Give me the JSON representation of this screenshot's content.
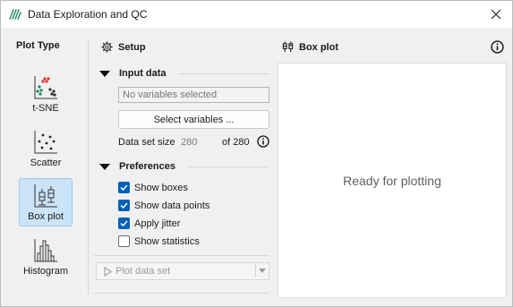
{
  "window": {
    "title": "Data Exploration and QC"
  },
  "plot_type": {
    "title": "Plot Type",
    "items": [
      {
        "label": "t-SNE",
        "icon": "tsne-icon",
        "selected": false
      },
      {
        "label": "Scatter",
        "icon": "scatter-icon",
        "selected": false
      },
      {
        "label": "Box plot",
        "icon": "boxplot-icon",
        "selected": true
      },
      {
        "label": "Histogram",
        "icon": "histogram-icon",
        "selected": false
      }
    ]
  },
  "setup": {
    "title": "Setup",
    "input_data": {
      "title": "Input data",
      "variables_placeholder": "No variables selected",
      "select_button": "Select variables ...",
      "dataset_size_label": "Data set size",
      "dataset_size_value": "280",
      "dataset_size_of": "of 280"
    },
    "preferences": {
      "title": "Preferences",
      "options": [
        {
          "label": "Show boxes",
          "checked": true
        },
        {
          "label": "Show data points",
          "checked": true
        },
        {
          "label": "Apply jitter",
          "checked": true
        },
        {
          "label": "Show statistics",
          "checked": false
        }
      ]
    },
    "plot_button": "Plot data set"
  },
  "plot_panel": {
    "title": "Box plot",
    "placeholder": "Ready for plotting"
  },
  "colors": {
    "accent": "#005fb8",
    "selected_bg": "#cce4f7"
  }
}
